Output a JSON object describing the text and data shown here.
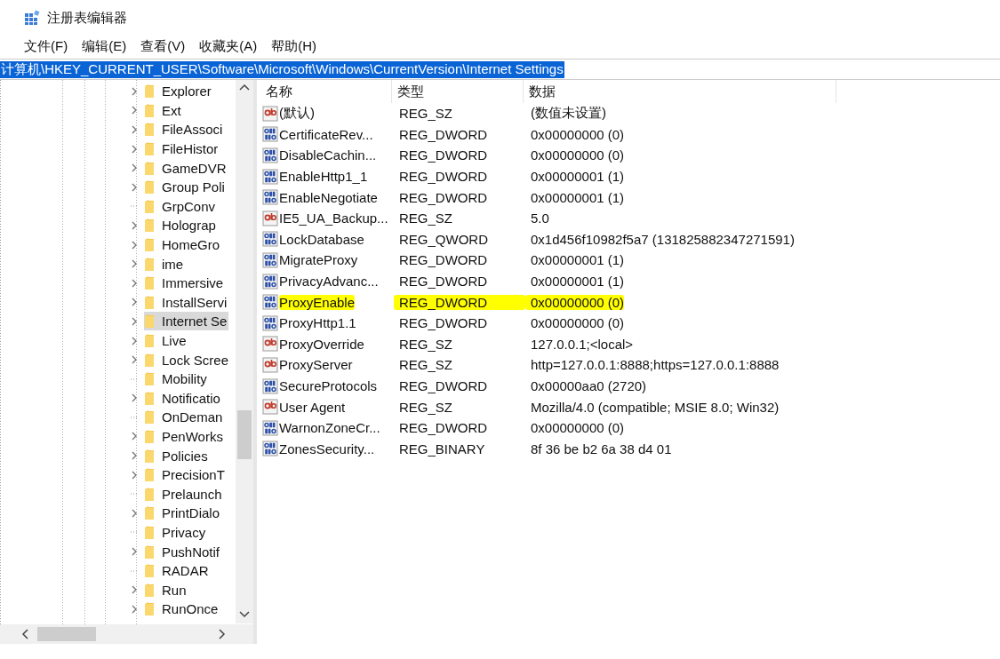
{
  "window": {
    "title": "注册表编辑器"
  },
  "menu": [
    "文件(F)",
    "编辑(E)",
    "查看(V)",
    "收藏夹(A)",
    "帮助(H)"
  ],
  "address": {
    "value": "计算机\\HKEY_CURRENT_USER\\Software\\Microsoft\\Windows\\CurrentVersion\\Internet Settings",
    "selected": true
  },
  "tree": [
    {
      "label": "Explorer",
      "expandable": true,
      "selected": false
    },
    {
      "label": "Ext",
      "expandable": true,
      "selected": false
    },
    {
      "label": "FileAssoci",
      "expandable": true,
      "selected": false
    },
    {
      "label": "FileHistor",
      "expandable": true,
      "selected": false
    },
    {
      "label": "GameDVR",
      "expandable": true,
      "selected": false
    },
    {
      "label": "Group Poli",
      "expandable": true,
      "selected": false
    },
    {
      "label": "GrpConv",
      "expandable": false,
      "selected": false
    },
    {
      "label": "Holograp",
      "expandable": true,
      "selected": false
    },
    {
      "label": "HomeGro",
      "expandable": true,
      "selected": false
    },
    {
      "label": "ime",
      "expandable": true,
      "selected": false
    },
    {
      "label": "Immersive",
      "expandable": true,
      "selected": false
    },
    {
      "label": "InstallServi",
      "expandable": true,
      "selected": false
    },
    {
      "label": "Internet Se",
      "expandable": true,
      "selected": true
    },
    {
      "label": "Live",
      "expandable": true,
      "selected": false
    },
    {
      "label": "Lock Scree",
      "expandable": true,
      "selected": false
    },
    {
      "label": "Mobility",
      "expandable": false,
      "selected": false
    },
    {
      "label": "Notificatio",
      "expandable": true,
      "selected": false
    },
    {
      "label": "OnDeman",
      "expandable": false,
      "selected": false
    },
    {
      "label": "PenWorks",
      "expandable": true,
      "selected": false
    },
    {
      "label": "Policies",
      "expandable": true,
      "selected": false
    },
    {
      "label": "PrecisionT",
      "expandable": true,
      "selected": false
    },
    {
      "label": "Prelaunch",
      "expandable": false,
      "selected": false
    },
    {
      "label": "PrintDialo",
      "expandable": true,
      "selected": false
    },
    {
      "label": "Privacy",
      "expandable": false,
      "selected": false
    },
    {
      "label": "PushNotif",
      "expandable": true,
      "selected": false
    },
    {
      "label": "RADAR",
      "expandable": false,
      "selected": false
    },
    {
      "label": "Run",
      "expandable": true,
      "selected": false
    },
    {
      "label": "RunOnce",
      "expandable": true,
      "selected": false
    }
  ],
  "table": {
    "columns": [
      "名称",
      "类型",
      "数据"
    ],
    "rows": [
      {
        "kind": "string",
        "name": "(默认)",
        "type": "REG_SZ",
        "data": "(数值未设置)",
        "highlighted": false
      },
      {
        "kind": "binary",
        "name": "CertificateRev...",
        "type": "REG_DWORD",
        "data": "0x00000000 (0)",
        "highlighted": false
      },
      {
        "kind": "binary",
        "name": "DisableCachin...",
        "type": "REG_DWORD",
        "data": "0x00000000 (0)",
        "highlighted": false
      },
      {
        "kind": "binary",
        "name": "EnableHttp1_1",
        "type": "REG_DWORD",
        "data": "0x00000001 (1)",
        "highlighted": false
      },
      {
        "kind": "binary",
        "name": "EnableNegotiate",
        "type": "REG_DWORD",
        "data": "0x00000001 (1)",
        "highlighted": false
      },
      {
        "kind": "string",
        "name": "IE5_UA_Backup...",
        "type": "REG_SZ",
        "data": "5.0",
        "highlighted": false
      },
      {
        "kind": "binary",
        "name": "LockDatabase",
        "type": "REG_QWORD",
        "data": "0x1d456f10982f5a7 (131825882347271591)",
        "highlighted": false
      },
      {
        "kind": "binary",
        "name": "MigrateProxy",
        "type": "REG_DWORD",
        "data": "0x00000001 (1)",
        "highlighted": false
      },
      {
        "kind": "binary",
        "name": "PrivacyAdvanc...",
        "type": "REG_DWORD",
        "data": "0x00000001 (1)",
        "highlighted": false
      },
      {
        "kind": "binary",
        "name": "ProxyEnable",
        "type": "REG_DWORD",
        "data": "0x00000000 (0)",
        "highlighted": true
      },
      {
        "kind": "binary",
        "name": "ProxyHttp1.1",
        "type": "REG_DWORD",
        "data": "0x00000000 (0)",
        "highlighted": false
      },
      {
        "kind": "string",
        "name": "ProxyOverride",
        "type": "REG_SZ",
        "data": "127.0.0.1;<local>",
        "highlighted": false
      },
      {
        "kind": "string",
        "name": "ProxyServer",
        "type": "REG_SZ",
        "data": "http=127.0.0.1:8888;https=127.0.0.1:8888",
        "highlighted": false
      },
      {
        "kind": "binary",
        "name": "SecureProtocols",
        "type": "REG_DWORD",
        "data": "0x00000aa0 (2720)",
        "highlighted": false
      },
      {
        "kind": "string",
        "name": "User Agent",
        "type": "REG_SZ",
        "data": "Mozilla/4.0 (compatible; MSIE 8.0; Win32)",
        "highlighted": false
      },
      {
        "kind": "binary",
        "name": "WarnonZoneCr...",
        "type": "REG_DWORD",
        "data": "0x00000000 (0)",
        "highlighted": false
      },
      {
        "kind": "binary",
        "name": "ZonesSecurity...",
        "type": "REG_BINARY",
        "data": "8f 36 be b2 6a 38 d4 01",
        "highlighted": false
      }
    ]
  }
}
